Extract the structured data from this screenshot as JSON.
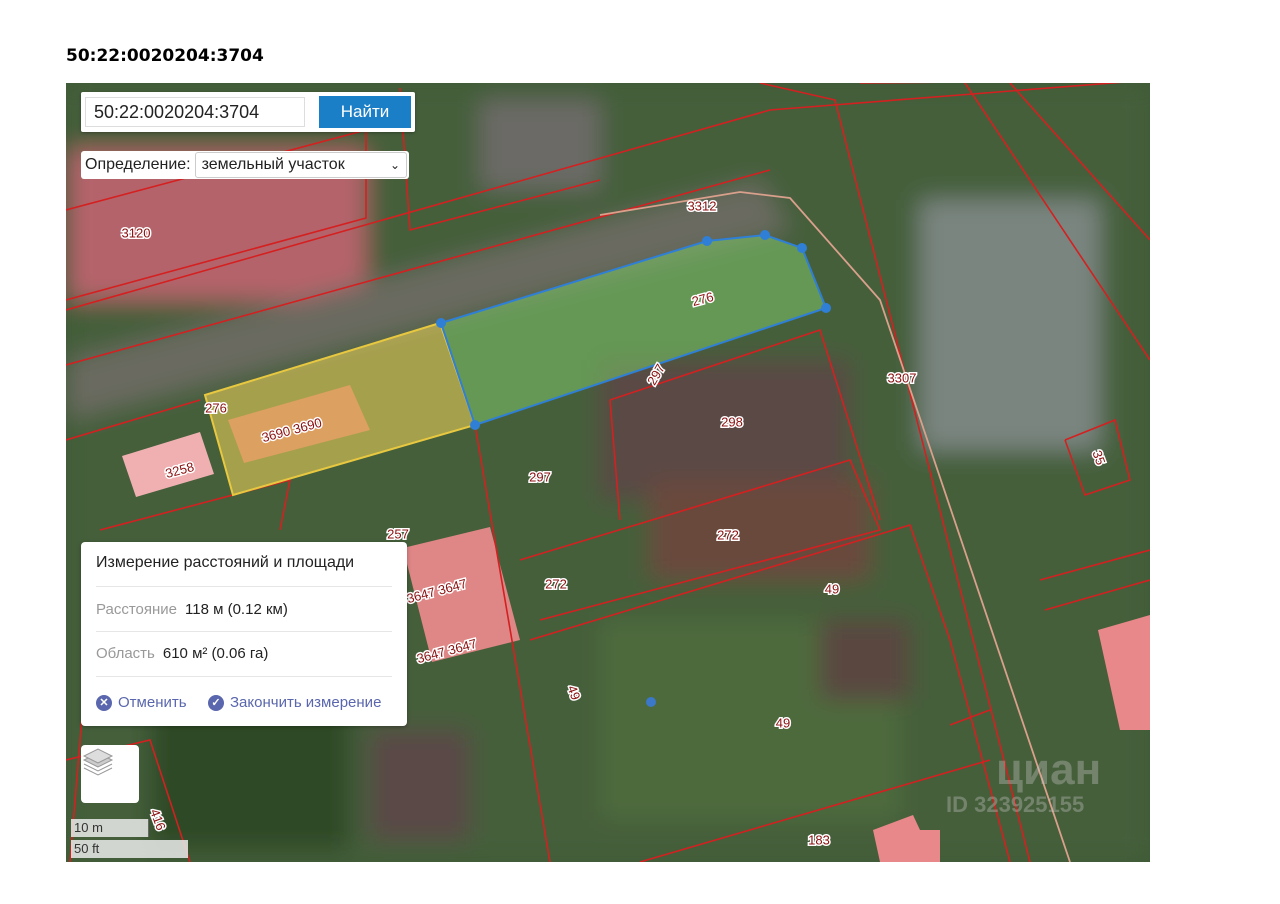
{
  "document_title": "50:22:0020204:3704",
  "search": {
    "value": "50:22:0020204:3704",
    "button_label": "Найти"
  },
  "definition": {
    "label": "Определение:",
    "selected": "земельный участок"
  },
  "measure_panel": {
    "title": "Измерение расстояний и площади",
    "distance_label": "Расстояние",
    "distance_value": "118 м (0.12 км)",
    "area_label": "Область",
    "area_value": "610 м² (0.06 га)",
    "cancel_label": "Отменить",
    "finish_label": "Закончить измерение"
  },
  "scale": {
    "metric": "10 m",
    "imperial": "50 ft"
  },
  "watermark": {
    "brand": "циан",
    "id": "ID 323925155"
  },
  "parcel_labels": [
    "3120",
    "3312",
    "276",
    "276",
    "3690 3690",
    "3258",
    "297",
    "298",
    "3307",
    "35",
    "297",
    "272",
    "257",
    "3647 3647",
    "3647 3647",
    "272",
    "49",
    "49",
    "49",
    "416",
    "183"
  ],
  "colors": {
    "boundary": "#d42020",
    "measure": "#2f7fd6",
    "selected": "#f2d55a",
    "building": "#e8888a"
  }
}
